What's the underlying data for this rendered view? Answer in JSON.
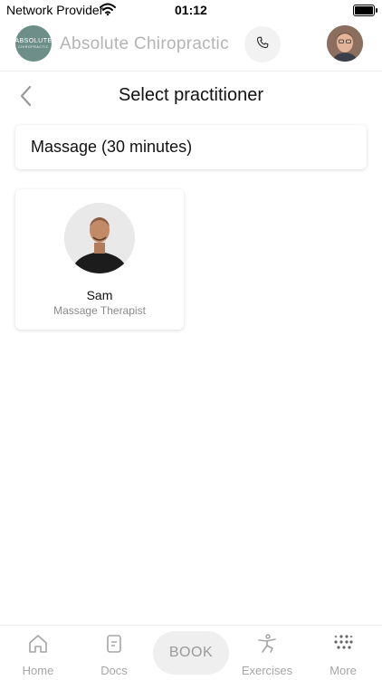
{
  "status_bar": {
    "carrier": "Network Provider",
    "time": "01:12",
    "icons": [
      "wifi-icon",
      "battery-icon"
    ]
  },
  "header": {
    "logo_line1": "ABSOLUTE",
    "logo_line2": "CHIROPRACTIC",
    "brand_name": "Absolute Chiropractic",
    "call_icon": "phone-icon",
    "brand_color": "#6e8e8a"
  },
  "page": {
    "title": "Select practitioner",
    "back_icon": "chevron-left-icon"
  },
  "service": {
    "label": "Massage (30 minutes)"
  },
  "practitioners": [
    {
      "name": "Sam",
      "role": "Massage Therapist"
    }
  ],
  "nav": {
    "items": [
      {
        "label": "Home",
        "icon": "home-icon"
      },
      {
        "label": "Docs",
        "icon": "document-icon"
      },
      {
        "label": "BOOK",
        "icon": ""
      },
      {
        "label": "Exercises",
        "icon": "exercise-icon"
      },
      {
        "label": "More",
        "icon": "grid-dots-icon"
      }
    ]
  }
}
